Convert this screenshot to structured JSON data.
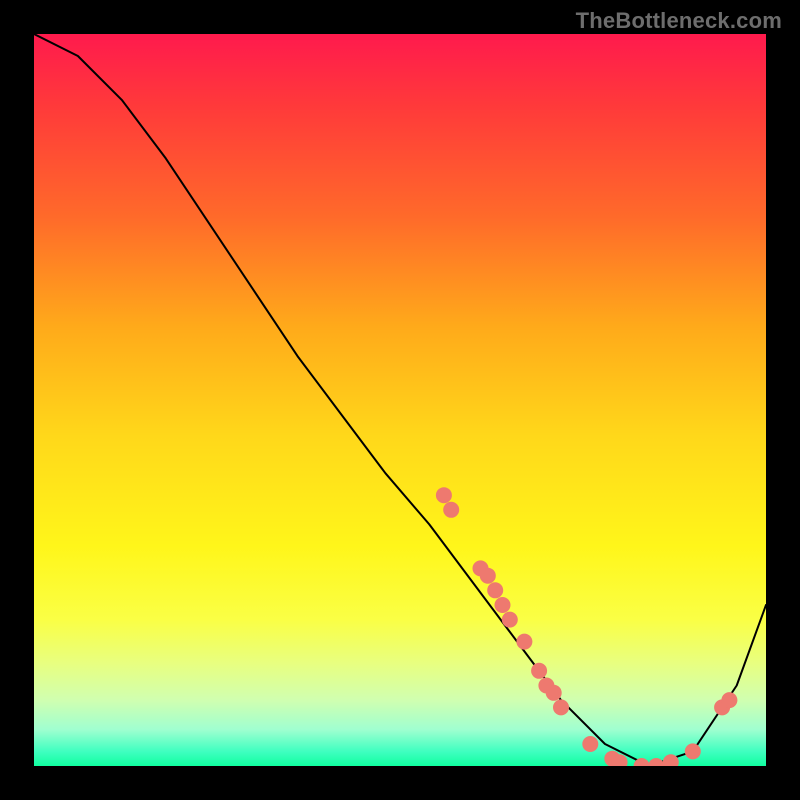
{
  "watermark": "TheBottleneck.com",
  "chart_data": {
    "type": "line",
    "title": "",
    "xlabel": "",
    "ylabel": "",
    "xlim": [
      0,
      100
    ],
    "ylim": [
      0,
      100
    ],
    "grid": false,
    "legend": false,
    "x": [
      0,
      6,
      12,
      18,
      24,
      30,
      36,
      42,
      48,
      54,
      60,
      66,
      72,
      78,
      84,
      90,
      96,
      100
    ],
    "values": [
      100,
      97,
      91,
      83,
      74,
      65,
      56,
      48,
      40,
      33,
      25,
      17,
      9,
      3,
      0,
      2,
      11,
      22
    ],
    "points": [
      {
        "x": 56,
        "y": 37
      },
      {
        "x": 57,
        "y": 35
      },
      {
        "x": 61,
        "y": 27
      },
      {
        "x": 62,
        "y": 26
      },
      {
        "x": 63,
        "y": 24
      },
      {
        "x": 64,
        "y": 22
      },
      {
        "x": 65,
        "y": 20
      },
      {
        "x": 67,
        "y": 17
      },
      {
        "x": 69,
        "y": 13
      },
      {
        "x": 70,
        "y": 11
      },
      {
        "x": 71,
        "y": 10
      },
      {
        "x": 72,
        "y": 8
      },
      {
        "x": 76,
        "y": 3
      },
      {
        "x": 79,
        "y": 1
      },
      {
        "x": 80,
        "y": 0.5
      },
      {
        "x": 83,
        "y": 0
      },
      {
        "x": 85,
        "y": 0
      },
      {
        "x": 87,
        "y": 0.5
      },
      {
        "x": 90,
        "y": 2
      },
      {
        "x": 94,
        "y": 8
      },
      {
        "x": 95,
        "y": 9
      }
    ],
    "curve_color": "#000000",
    "point_color": "#ee796f",
    "point_radius": 8
  }
}
